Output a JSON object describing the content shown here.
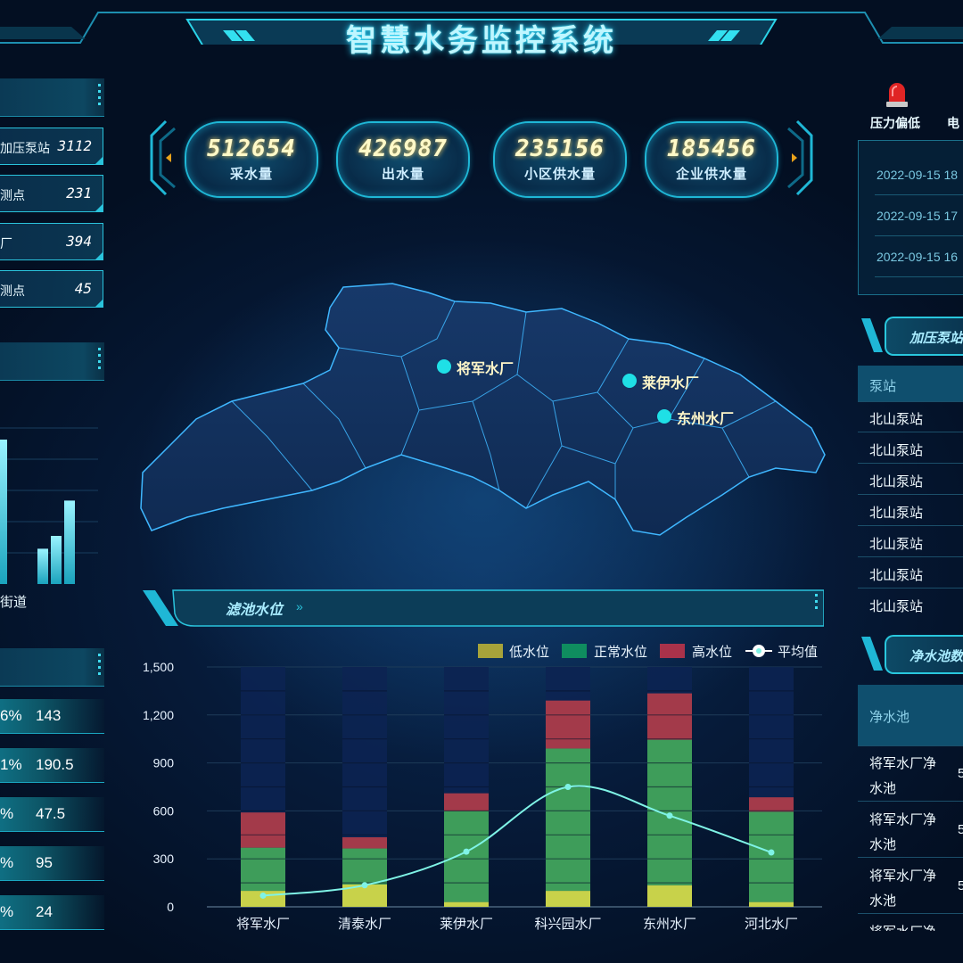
{
  "header": {
    "title": "智慧水务监控系统"
  },
  "stats": [
    {
      "value": "512654",
      "label": "采水量"
    },
    {
      "value": "426987",
      "label": "出水量"
    },
    {
      "value": "235156",
      "label": "小区供水量"
    },
    {
      "value": "185456",
      "label": "企业供水量"
    }
  ],
  "left_counts": [
    {
      "label": "加压泵站",
      "value": "3112"
    },
    {
      "label": "测点",
      "value": "231"
    },
    {
      "label": "厂",
      "value": "394"
    },
    {
      "label": "测点",
      "value": "45"
    }
  ],
  "left_bar_chart": {
    "category_label": "街道",
    "values": [
      0.9,
      0.22,
      0.3,
      0.52
    ]
  },
  "left_pct_rows": [
    {
      "pct": "6%",
      "value": "143"
    },
    {
      "pct": "1%",
      "value": "190.5"
    },
    {
      "pct": "%",
      "value": "47.5"
    },
    {
      "pct": "%",
      "value": "95"
    },
    {
      "pct": "%",
      "value": "24"
    }
  ],
  "map": {
    "plants": [
      {
        "name": "将军水厂"
      },
      {
        "name": "莱伊水厂"
      },
      {
        "name": "东州水厂"
      }
    ]
  },
  "alarms": {
    "types": [
      "压力偏低",
      "电"
    ],
    "items": [
      "2022-09-15 18",
      "2022-09-15 17",
      "2022-09-15 16"
    ]
  },
  "pump_panel": {
    "title": "加压泵站",
    "header": "泵站",
    "rows": [
      "北山泵站",
      "北山泵站",
      "北山泵站",
      "北山泵站",
      "北山泵站",
      "北山泵站",
      "北山泵站"
    ]
  },
  "pool_panel": {
    "title": "净水池数",
    "header": "净水池",
    "rows": [
      {
        "line1": "将军水厂净",
        "line2": "水池",
        "val": "5"
      },
      {
        "line1": "将军水厂净",
        "line2": "水池",
        "val": "5"
      },
      {
        "line1": "将军水厂净",
        "line2": "水池",
        "val": "5"
      },
      {
        "line1": "将军水厂净",
        "line2": "",
        "val": ""
      }
    ]
  },
  "chart_panel": {
    "title": "滤池水位"
  },
  "colors": {
    "low": "#c8d24a",
    "normal": "#3e9d5a",
    "high": "#a33a4a",
    "avg_line": "#7ff3e6",
    "legend_low": "#a7a33a",
    "legend_normal": "#0f8d5f",
    "legend_high": "#a9324a"
  },
  "chart_data": {
    "type": "bar",
    "stacked": true,
    "categories": [
      "将军水厂",
      "清泰水厂",
      "莱伊水厂",
      "科兴园水厂",
      "东州水厂",
      "河北水厂"
    ],
    "series": [
      {
        "name": "低水位",
        "values": [
          100,
          140,
          30,
          100,
          135,
          30
        ]
      },
      {
        "name": "正常水位",
        "values": [
          270,
          225,
          570,
          890,
          910,
          565
        ]
      },
      {
        "name": "高水位",
        "values": [
          220,
          70,
          110,
          300,
          290,
          90
        ]
      },
      {
        "name": "平均值",
        "type": "line",
        "values": [
          70,
          135,
          345,
          750,
          570,
          340
        ]
      }
    ],
    "ylim": [
      0,
      1500
    ],
    "yticks": [
      "0",
      "300",
      "600",
      "900",
      "1,200",
      "1,500"
    ],
    "legend_position": "top-right",
    "grid": true
  }
}
